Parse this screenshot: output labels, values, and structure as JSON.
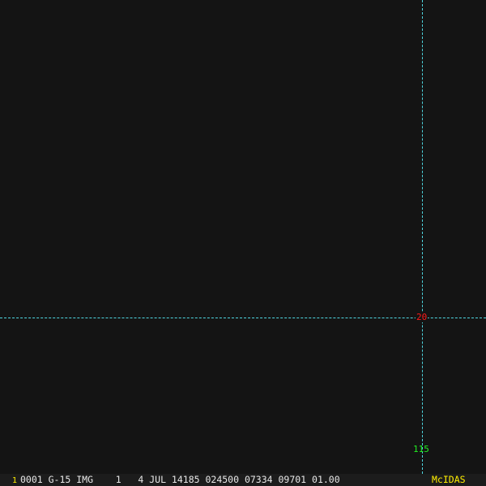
{
  "image": {
    "grid_latitude_label": "20",
    "grid_longitude_label": "115",
    "grid_color": "#4fd6e0",
    "latitude_color": "#ff1a1a",
    "longitude_color": "#22ee22"
  },
  "status_bar": {
    "frame_number": "1",
    "info": "0001 G-15 IMG    1   4 JUL 14185 024500 07334 09701 01.00",
    "brand": "McIDAS",
    "brand_color": "#ffee00"
  }
}
